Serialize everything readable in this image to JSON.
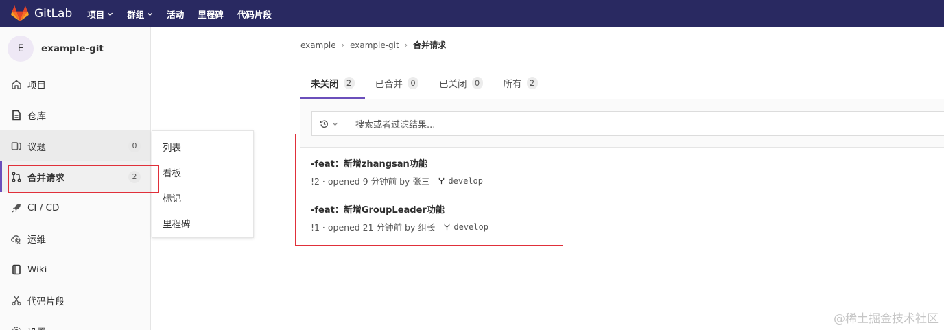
{
  "navbar": {
    "brand": "GitLab",
    "items": [
      {
        "label": "项目",
        "dropdown": true
      },
      {
        "label": "群组",
        "dropdown": true
      },
      {
        "label": "活动",
        "dropdown": false
      },
      {
        "label": "里程碑",
        "dropdown": false
      },
      {
        "label": "代码片段",
        "dropdown": false
      }
    ]
  },
  "sidebar": {
    "avatar_letter": "E",
    "project_name": "example-git",
    "items": [
      {
        "label": "项目",
        "icon": "home-icon"
      },
      {
        "label": "仓库",
        "icon": "doc-icon"
      },
      {
        "label": "议题",
        "icon": "issues-icon",
        "count": "0"
      },
      {
        "label": "合并请求",
        "icon": "merge-request-icon",
        "count": "2"
      },
      {
        "label": "CI / CD",
        "icon": "rocket-icon"
      },
      {
        "label": "运维",
        "icon": "cloud-gear-icon"
      },
      {
        "label": "Wiki",
        "icon": "book-icon"
      },
      {
        "label": "代码片段",
        "icon": "scissors-icon"
      },
      {
        "label": "设置",
        "icon": "settings-icon"
      }
    ]
  },
  "flyout": {
    "items": [
      "列表",
      "看板",
      "标记",
      "里程碑"
    ]
  },
  "breadcrumb": {
    "items": [
      "example",
      "example-git",
      "合并请求"
    ]
  },
  "tabs": [
    {
      "label": "未关闭",
      "count": "2"
    },
    {
      "label": "已合并",
      "count": "0"
    },
    {
      "label": "已关闭",
      "count": "0"
    },
    {
      "label": "所有",
      "count": "2"
    }
  ],
  "search": {
    "placeholder": "搜索或者过滤结果..."
  },
  "merge_requests": [
    {
      "title": "-feat：新增zhangsan功能",
      "meta": "!2 · opened 9 分钟前 by 张三",
      "branch": "develop"
    },
    {
      "title": "-feat：新增GroupLeader功能",
      "meta": "!1 · opened 21 分钟前 by 组长",
      "branch": "develop"
    }
  ],
  "watermark": "@稀土掘金技术社区",
  "colors": {
    "navbar": "#292961",
    "accent": "#6b4fbb",
    "highlight_box": "#e0303a"
  }
}
